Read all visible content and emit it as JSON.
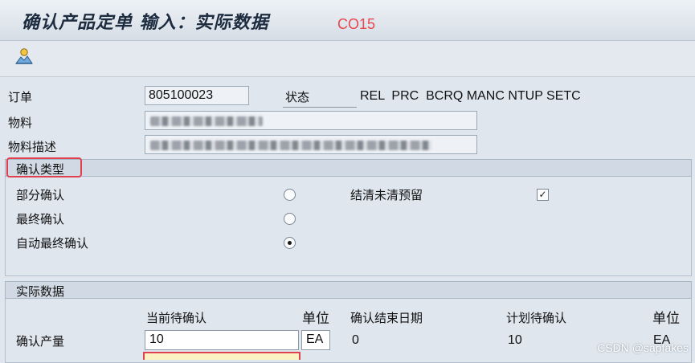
{
  "header": {
    "title": "确认产品定单 输入：实际数据",
    "tcode": "CO15"
  },
  "toolbar": {
    "icons": [
      "user-mountain-icon"
    ]
  },
  "order": {
    "label": "订单",
    "value": "805100023",
    "status_label": "状态",
    "status_value": "REL  PRC  BCRQ MANC NTUP SETC"
  },
  "material": {
    "label": "物料",
    "desc_label": "物料描述"
  },
  "confirmation_type": {
    "title": "确认类型",
    "options": [
      {
        "label": "部分确认",
        "selected": false
      },
      {
        "label": "最终确认",
        "selected": false
      },
      {
        "label": "自动最终确认",
        "selected": true
      }
    ],
    "clear_reservations_label": "结清未清预留",
    "clear_reservations_checked": true
  },
  "actual_data": {
    "title": "实际数据",
    "col_current_to_confirm": "当前待确认",
    "col_unit": "单位",
    "col_confirm_end_date": "确认结束日期",
    "col_planned_to_confirm": "计划待确认",
    "col_unit2": "单位",
    "row_label": "确认产量",
    "current_value": "10",
    "current_unit": "EA",
    "end_date_value": "0",
    "planned_value": "10",
    "planned_unit": "EA"
  },
  "watermark": "CSDN @sapfakes",
  "colors": {
    "highlight": "#e0404f",
    "tcode": "#e8484e"
  }
}
